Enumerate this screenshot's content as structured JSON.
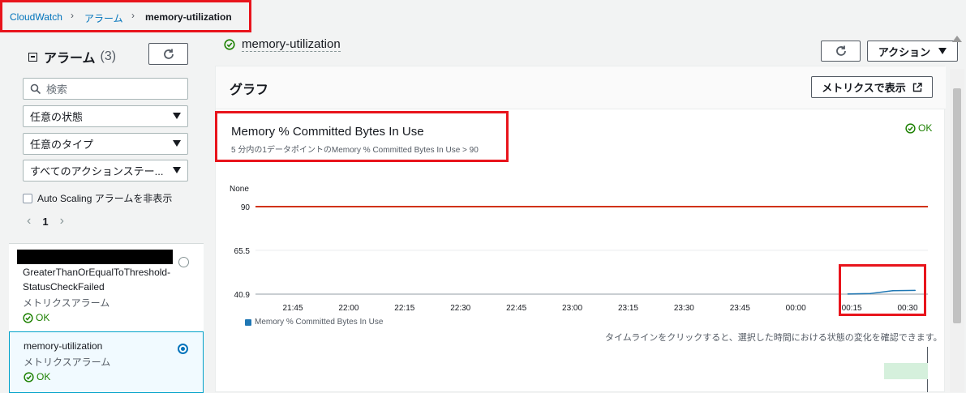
{
  "breadcrumb": {
    "items": [
      {
        "label": "CloudWatch"
      },
      {
        "label": "アラーム"
      },
      {
        "label": "memory-utilization"
      }
    ]
  },
  "sidebar": {
    "heading": "アラーム",
    "count": "(3)",
    "search_placeholder": "検索",
    "filters": [
      {
        "value": "任意の状態"
      },
      {
        "value": "任意のタイプ"
      },
      {
        "value": "すべてのアクションステー..."
      }
    ],
    "hide_autoscaling_label": "Auto Scaling アラームを非表示",
    "pager": {
      "current": "1"
    },
    "alarms": [
      {
        "name": "GreaterThanOrEqualToThreshold-StatusCheckFailed",
        "type": "メトリクスアラーム",
        "state": "OK"
      },
      {
        "name": "memory-utilization",
        "type": "メトリクスアラーム",
        "state": "OK"
      }
    ]
  },
  "header": {
    "title": "memory-utilization",
    "actions_label": "アクション"
  },
  "graph": {
    "heading": "グラフ",
    "view_metrics_label": "メトリクスで表示",
    "chart_title": "Memory % Committed Bytes In Use",
    "chart_subtitle": "5 分内の1データポイントのMemory % Committed Bytes In Use > 90",
    "state": "OK",
    "timeline_note": "タイムラインをクリックすると、選択した時間における状態の変化を確認できます。"
  },
  "colors": {
    "threshold": "#d13212",
    "series": "#1f77b4",
    "ok": "#1d8102",
    "link": "#0073bb"
  },
  "chart_data": {
    "type": "line",
    "title": "Memory % Committed Bytes In Use",
    "ylabel": "None",
    "yticks": [
      "90",
      "65.5",
      "40.9"
    ],
    "ylim": [
      40.9,
      90
    ],
    "xticks": [
      "21:45",
      "22:00",
      "22:15",
      "22:30",
      "22:45",
      "23:00",
      "23:15",
      "23:30",
      "23:45",
      "00:00",
      "00:15",
      "00:30"
    ],
    "threshold": {
      "value": 90
    },
    "series": [
      {
        "name": "Memory % Committed Bytes In Use",
        "x": [
          "00:14",
          "00:20",
          "00:26",
          "00:32"
        ],
        "values": [
          41.0,
          41.2,
          42.8,
          43.0
        ]
      }
    ],
    "grid": true
  }
}
